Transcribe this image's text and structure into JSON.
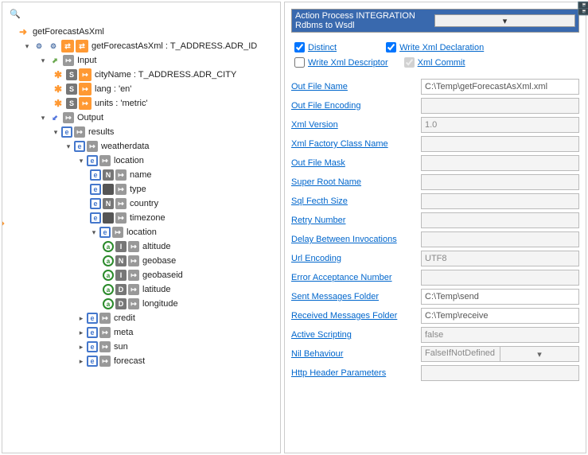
{
  "tree": {
    "root": "getForecastAsXml",
    "rootNode": "getForecastAsXml : T_ADDRESS.ADR_ID",
    "input": "Input",
    "cityName": "cityName : T_ADDRESS.ADR_CITY",
    "lang": "lang : 'en'",
    "units": "units : 'metric'",
    "output": "Output",
    "results": "results",
    "weatherdata": "weatherdata",
    "location": "location",
    "name": "name",
    "type": "type",
    "country": "country",
    "timezone": "timezone",
    "location2": "location",
    "altitude": "altitude",
    "geobase": "geobase",
    "geobaseid": "geobaseid",
    "latitude": "latitude",
    "longitude": "longitude",
    "credit": "credit",
    "meta": "meta",
    "sun": "sun",
    "forecast": "forecast"
  },
  "panel": {
    "selected": "Action Process INTEGRATION Rdbms to Wsdl",
    "checks": {
      "distinct": "Distinct",
      "writeXmlDecl": "Write Xml Declaration",
      "writeXmlDesc": "Write Xml Descriptor",
      "xmlCommit": "Xml Commit"
    },
    "props": {
      "outFileName": {
        "label": "Out File Name",
        "value": "C:\\Temp\\getForecastAsXml.xml"
      },
      "outFileEncoding": {
        "label": "Out File Encoding",
        "value": ""
      },
      "xmlVersion": {
        "label": "Xml Version",
        "value": "1.0"
      },
      "xmlFactoryClassName": {
        "label": "Xml Factory Class Name",
        "value": ""
      },
      "outFileMask": {
        "label": "Out File Mask",
        "value": ""
      },
      "superRootName": {
        "label": "Super Root Name",
        "value": ""
      },
      "sqlFetchSize": {
        "label": "Sql Fecth Size",
        "value": ""
      },
      "retryNumber": {
        "label": "Retry Number",
        "value": ""
      },
      "delayBetween": {
        "label": "Delay Between Invocations",
        "value": ""
      },
      "urlEncoding": {
        "label": "Url Encoding",
        "value": "UTF8"
      },
      "errorAcceptance": {
        "label": "Error Acceptance Number",
        "value": ""
      },
      "sentFolder": {
        "label": "Sent Messages Folder",
        "value": "C:\\Temp\\send"
      },
      "receivedFolder": {
        "label": "Received Messages Folder",
        "value": "C:\\Temp\\receive"
      },
      "activeScripting": {
        "label": "Active Scripting",
        "value": "false"
      },
      "nilBehaviour": {
        "label": "Nil Behaviour",
        "value": "FalseIfNotDefined"
      },
      "httpHeader": {
        "label": "Http Header Parameters",
        "value": ""
      }
    }
  }
}
